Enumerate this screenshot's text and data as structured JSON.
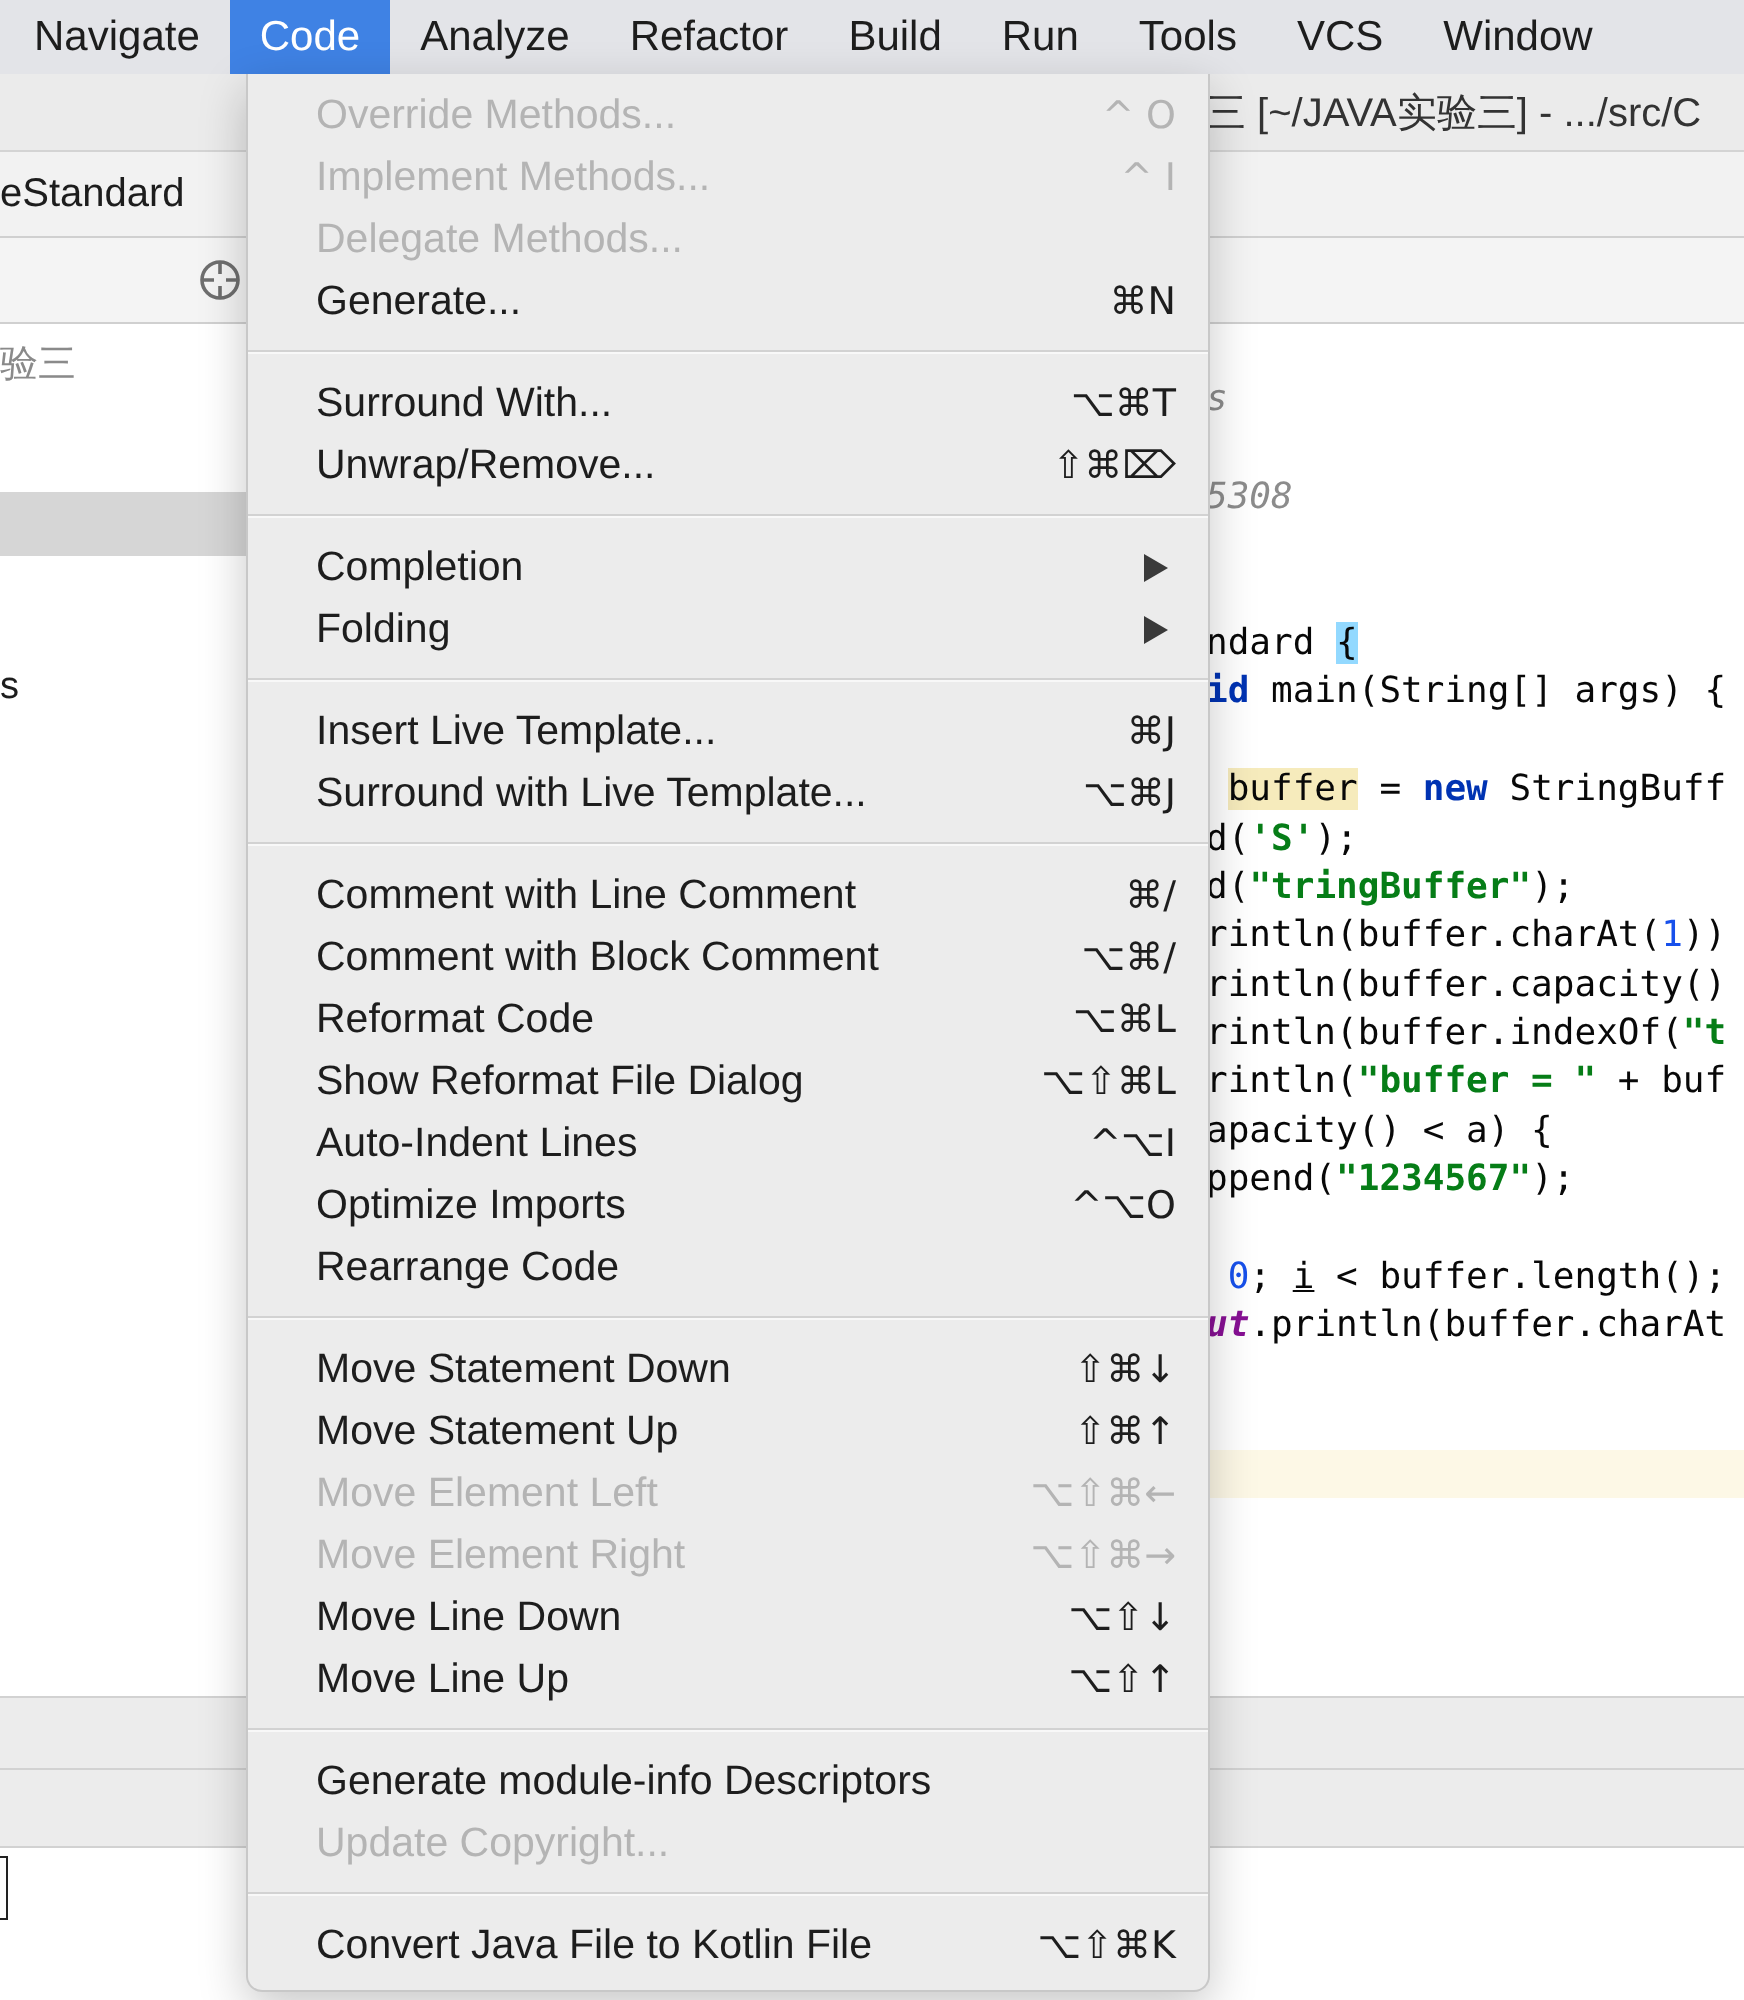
{
  "menu_bar": [
    {
      "label": "Navigate",
      "selected": false
    },
    {
      "label": "Code",
      "selected": true
    },
    {
      "label": "Analyze",
      "selected": false
    },
    {
      "label": "Refactor",
      "selected": false
    },
    {
      "label": "Build",
      "selected": false
    },
    {
      "label": "Run",
      "selected": false
    },
    {
      "label": "Tools",
      "selected": false
    },
    {
      "label": "VCS",
      "selected": false
    },
    {
      "label": "Window",
      "selected": false
    }
  ],
  "window": {
    "title": "三 [~/JAVA实验三] - .../src/C"
  },
  "navigation_bar": {
    "crumb": "eStandard"
  },
  "project_pane": {
    "items": [
      {
        "label": "验三",
        "selected": false,
        "dimmed": true
      },
      {
        "selected": true,
        "dimmed": false
      },
      {
        "label": "s",
        "selected": false,
        "dimmed": false
      }
    ]
  },
  "editor": {
    "lines": [
      {
        "kind": "code",
        "segments": [
          {
            "kind": "comment",
            "text": "s"
          }
        ]
      },
      {
        "kind": "blank"
      },
      {
        "kind": "code",
        "segments": [
          {
            "kind": "comment",
            "text": "5308"
          }
        ]
      },
      {
        "kind": "blank"
      },
      {
        "kind": "blank"
      },
      {
        "kind": "code",
        "segments": [
          {
            "kind": "plain",
            "text": "ndard "
          },
          {
            "kind": "brace",
            "text": "{"
          }
        ]
      },
      {
        "kind": "code",
        "segments": [
          {
            "kind": "keyword",
            "text": "id"
          },
          {
            "kind": "plain",
            "text": " main(String[] args) {"
          }
        ]
      },
      {
        "kind": "blank"
      },
      {
        "kind": "code",
        "indented": true,
        "segments": [
          {
            "kind": "usage",
            "text": "buffer"
          },
          {
            "kind": "plain",
            "text": " = "
          },
          {
            "kind": "keyword",
            "text": "new"
          },
          {
            "kind": "plain",
            "text": " StringBuff"
          }
        ]
      },
      {
        "kind": "code",
        "segments": [
          {
            "kind": "plain",
            "text": "d("
          },
          {
            "kind": "string",
            "text": "'S'"
          },
          {
            "kind": "plain",
            "text": ");"
          }
        ]
      },
      {
        "kind": "code",
        "segments": [
          {
            "kind": "plain",
            "text": "d("
          },
          {
            "kind": "string",
            "text": "\"tringBuffer\""
          },
          {
            "kind": "plain",
            "text": ");"
          }
        ]
      },
      {
        "kind": "code",
        "segments": [
          {
            "kind": "plain",
            "text": "rintln(buffer.charAt("
          },
          {
            "kind": "number",
            "text": "1"
          },
          {
            "kind": "plain",
            "text": "))"
          }
        ]
      },
      {
        "kind": "code",
        "segments": [
          {
            "kind": "plain",
            "text": "rintln(buffer.capacity()"
          }
        ]
      },
      {
        "kind": "code",
        "segments": [
          {
            "kind": "plain",
            "text": "rintln(buffer.indexOf("
          },
          {
            "kind": "string",
            "text": "\"t"
          }
        ]
      },
      {
        "kind": "code",
        "segments": [
          {
            "kind": "plain",
            "text": "rintln("
          },
          {
            "kind": "string",
            "text": "\"buffer = \""
          },
          {
            "kind": "plain",
            "text": " + buf"
          }
        ]
      },
      {
        "kind": "code",
        "segments": [
          {
            "kind": "plain",
            "text": "apacity() < a) {"
          }
        ]
      },
      {
        "kind": "code",
        "segments": [
          {
            "kind": "plain",
            "text": "ppend("
          },
          {
            "kind": "string",
            "text": "\"1234567\""
          },
          {
            "kind": "plain",
            "text": ");"
          }
        ]
      },
      {
        "kind": "blank"
      },
      {
        "kind": "code",
        "indented": true,
        "segments": [
          {
            "kind": "number",
            "text": "0"
          },
          {
            "kind": "plain",
            "text": "; "
          },
          {
            "kind": "variable",
            "text": "i"
          },
          {
            "kind": "plain",
            "text": " < buffer.length();"
          }
        ]
      },
      {
        "kind": "code",
        "segments": [
          {
            "kind": "field",
            "text": "ut"
          },
          {
            "kind": "plain",
            "text": ".println(buffer.charAt"
          }
        ]
      },
      {
        "kind": "blank"
      },
      {
        "kind": "blank"
      },
      {
        "kind": "current"
      }
    ]
  },
  "code_menu": {
    "groups": [
      {
        "items": [
          {
            "label": "Override Methods...",
            "shortcut": "^ O",
            "disabled": true,
            "submenu": false
          },
          {
            "label": "Implement Methods...",
            "shortcut": "^ I",
            "disabled": true,
            "submenu": false
          },
          {
            "label": "Delegate Methods...",
            "disabled": true,
            "submenu": false
          },
          {
            "label": "Generate...",
            "shortcut": "⌘N",
            "disabled": false,
            "submenu": false
          }
        ]
      },
      {
        "items": [
          {
            "label": "Surround With...",
            "shortcut": "⌥⌘T",
            "disabled": false,
            "submenu": false
          },
          {
            "label": "Unwrap/Remove...",
            "shortcut": "⇧⌘⌦",
            "disabled": false,
            "submenu": false
          }
        ]
      },
      {
        "items": [
          {
            "label": "Completion",
            "disabled": false,
            "submenu": true
          },
          {
            "label": "Folding",
            "disabled": false,
            "submenu": true
          }
        ]
      },
      {
        "items": [
          {
            "label": "Insert Live Template...",
            "shortcut": "⌘J",
            "disabled": false,
            "submenu": false
          },
          {
            "label": "Surround with Live Template...",
            "shortcut": "⌥⌘J",
            "disabled": false,
            "submenu": false
          }
        ]
      },
      {
        "items": [
          {
            "label": "Comment with Line Comment",
            "shortcut": "⌘/",
            "disabled": false,
            "submenu": false
          },
          {
            "label": "Comment with Block Comment",
            "shortcut": "⌥⌘/",
            "disabled": false,
            "submenu": false
          },
          {
            "label": "Reformat Code",
            "shortcut": "⌥⌘L",
            "disabled": false,
            "submenu": false
          },
          {
            "label": "Show Reformat File Dialog",
            "shortcut": "⌥⇧⌘L",
            "disabled": false,
            "submenu": false
          },
          {
            "label": "Auto-Indent Lines",
            "shortcut": "^⌥I",
            "disabled": false,
            "submenu": false
          },
          {
            "label": "Optimize Imports",
            "shortcut": "^⌥O",
            "disabled": false,
            "submenu": false
          },
          {
            "label": "Rearrange Code",
            "disabled": false,
            "submenu": false
          }
        ]
      },
      {
        "items": [
          {
            "label": "Move Statement Down",
            "shortcut": "⇧⌘↓",
            "disabled": false,
            "submenu": false
          },
          {
            "label": "Move Statement Up",
            "shortcut": "⇧⌘↑",
            "disabled": false,
            "submenu": false
          },
          {
            "label": "Move Element Left",
            "shortcut": "⌥⇧⌘←",
            "disabled": true,
            "submenu": false
          },
          {
            "label": "Move Element Right",
            "shortcut": "⌥⇧⌘→",
            "disabled": true,
            "submenu": false
          },
          {
            "label": "Move Line Down",
            "shortcut": "⌥⇧↓",
            "disabled": false,
            "submenu": false
          },
          {
            "label": "Move Line Up",
            "shortcut": "⌥⇧↑",
            "disabled": false,
            "submenu": false
          }
        ]
      },
      {
        "items": [
          {
            "label": "Generate module-info Descriptors",
            "disabled": false,
            "submenu": false
          },
          {
            "label": "Update Copyright...",
            "disabled": true,
            "submenu": false
          }
        ]
      },
      {
        "items": [
          {
            "label": "Convert Java File to Kotlin File",
            "shortcut": "⌥⇧⌘K",
            "disabled": false,
            "submenu": false
          }
        ]
      }
    ]
  }
}
